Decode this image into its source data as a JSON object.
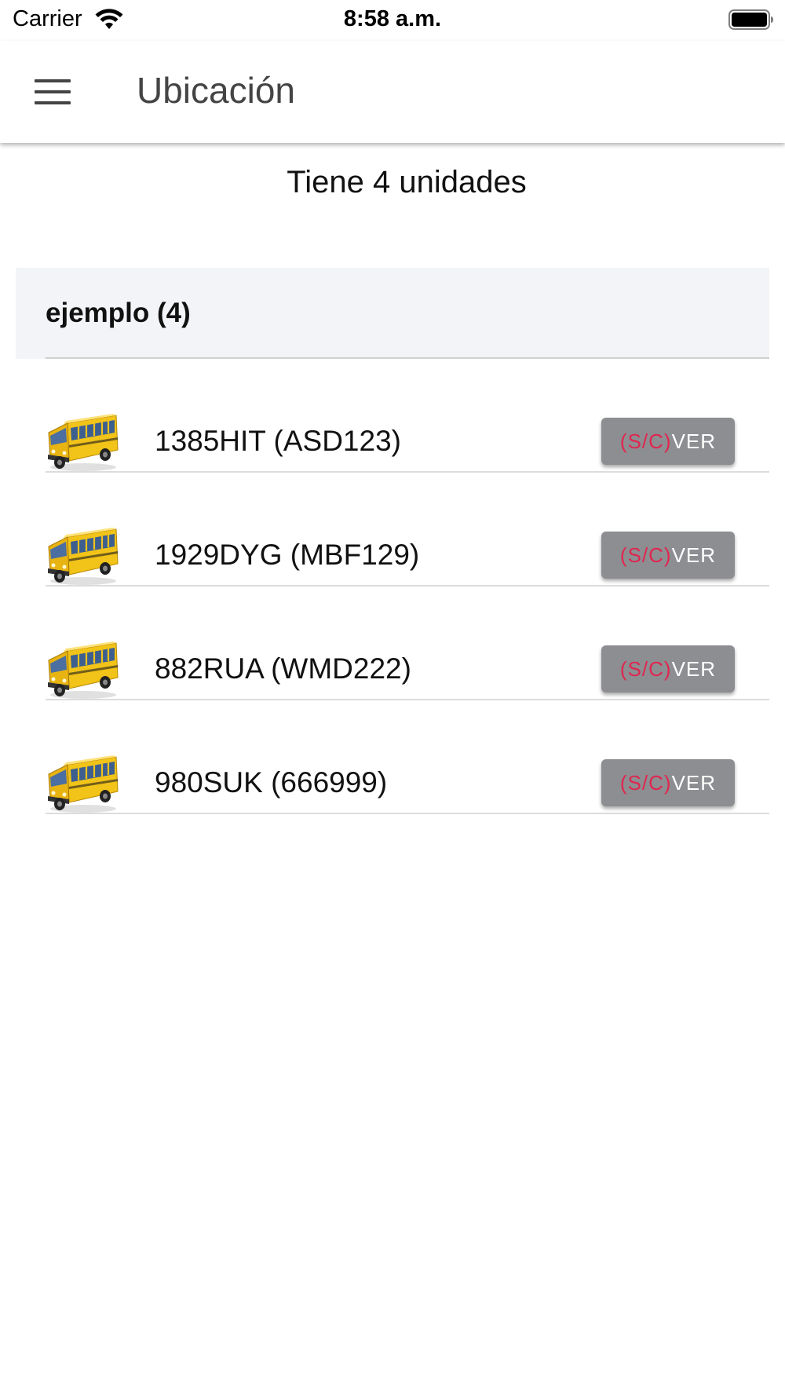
{
  "status_bar": {
    "carrier": "Carrier",
    "time": "8:58 a.m.",
    "icons": [
      "wifi-icon",
      "battery-icon"
    ]
  },
  "navbar": {
    "menu_icon": "hamburger-menu-icon",
    "title": "Ubicación"
  },
  "summary": "Tiene 4 unidades",
  "group": {
    "title": "ejemplo (4)"
  },
  "units": [
    {
      "label": "1385HIT (ASD123)",
      "status": "(S/C)",
      "action": "VER",
      "icon": "school-bus-icon"
    },
    {
      "label": "1929DYG (MBF129)",
      "status": "(S/C)",
      "action": "VER",
      "icon": "school-bus-icon"
    },
    {
      "label": "882RUA (WMD222)",
      "status": "(S/C)",
      "action": "VER",
      "icon": "school-bus-icon"
    },
    {
      "label": "980SUK (666999)",
      "status": "(S/C)",
      "action": "VER",
      "icon": "school-bus-icon"
    }
  ],
  "colors": {
    "button_bg": "#8d8e92",
    "status_text": "#e0264e",
    "group_bg": "#f3f4f7"
  }
}
